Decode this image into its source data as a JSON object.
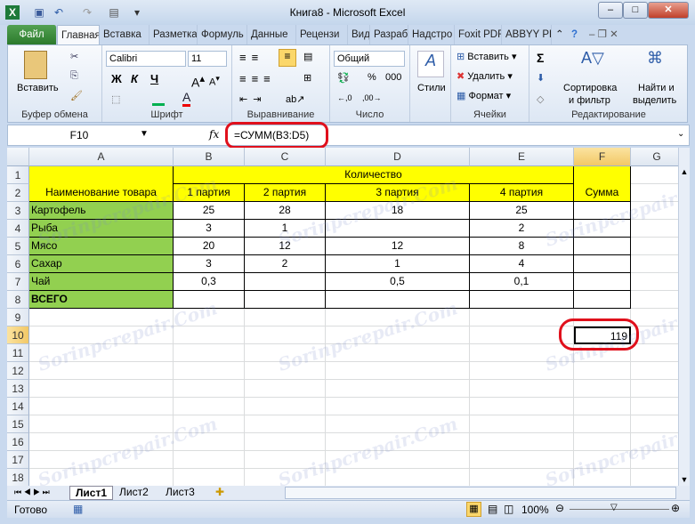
{
  "window": {
    "title": "Книга8 - Microsoft Excel"
  },
  "tabs": [
    "Файл",
    "Главная",
    "Вставка",
    "Разметка",
    "Формуль",
    "Данные",
    "Рецензи",
    "Вид",
    "Разрабо",
    "Надстро",
    "Foxit PDF",
    "ABBYY PD"
  ],
  "ribbon": {
    "clipboard": {
      "paste": "Вставить",
      "label": "Буфер обмена"
    },
    "font": {
      "name": "Calibri",
      "size": "11",
      "bold": "Ж",
      "italic": "К",
      "underline": "Ч",
      "label": "Шрифт"
    },
    "alignment": {
      "label": "Выравнивание"
    },
    "number": {
      "format": "Общий",
      "percent": "%",
      "thousands": "000",
      "label": "Число"
    },
    "styles": {
      "label": "Стили"
    },
    "cells": {
      "insert": "Вставить",
      "delete": "Удалить",
      "format": "Формат",
      "label": "Ячейки"
    },
    "editing": {
      "sort1": "Сортировка",
      "sort2": "и фильтр",
      "find1": "Найти и",
      "find2": "выделить",
      "label": "Редактирование",
      "sigma": "Σ"
    }
  },
  "formula_bar": {
    "name_box": "F10",
    "fx": "fx",
    "formula": "=СУММ(B3:D5)"
  },
  "columns": [
    "A",
    "B",
    "C",
    "D",
    "E",
    "F",
    "G"
  ],
  "rows": [
    "1",
    "2",
    "3",
    "4",
    "5",
    "6",
    "7",
    "8",
    "9",
    "10",
    "11",
    "12",
    "13",
    "14",
    "15",
    "16",
    "17",
    "18"
  ],
  "table": {
    "header_quantity": "Количество",
    "header_name": "Наименование товара",
    "header_sum": "Сумма",
    "batches": [
      "1 партия",
      "2 партия",
      "3 партия",
      "4 партия"
    ],
    "items": [
      {
        "name": "Картофель",
        "values": [
          "25",
          "28",
          "18",
          "25"
        ]
      },
      {
        "name": "Рыба",
        "values": [
          "3",
          "1",
          "",
          "2"
        ]
      },
      {
        "name": "Мясо",
        "values": [
          "20",
          "12",
          "12",
          "8"
        ]
      },
      {
        "name": "Сахар",
        "values": [
          "3",
          "2",
          "1",
          "4"
        ]
      },
      {
        "name": "Чай",
        "values": [
          "0,3",
          "",
          "0,5",
          "0,1"
        ]
      },
      {
        "name": "ВСЕГО",
        "values": [
          "",
          "",
          "",
          ""
        ]
      }
    ],
    "f10": "119"
  },
  "sheets": [
    "Лист1",
    "Лист2",
    "Лист3"
  ],
  "status": {
    "ready": "Готово",
    "zoom": "100%"
  },
  "colors": {
    "yellow": "#ffff00",
    "green": "#92d050",
    "highlight": "#e0101c"
  }
}
